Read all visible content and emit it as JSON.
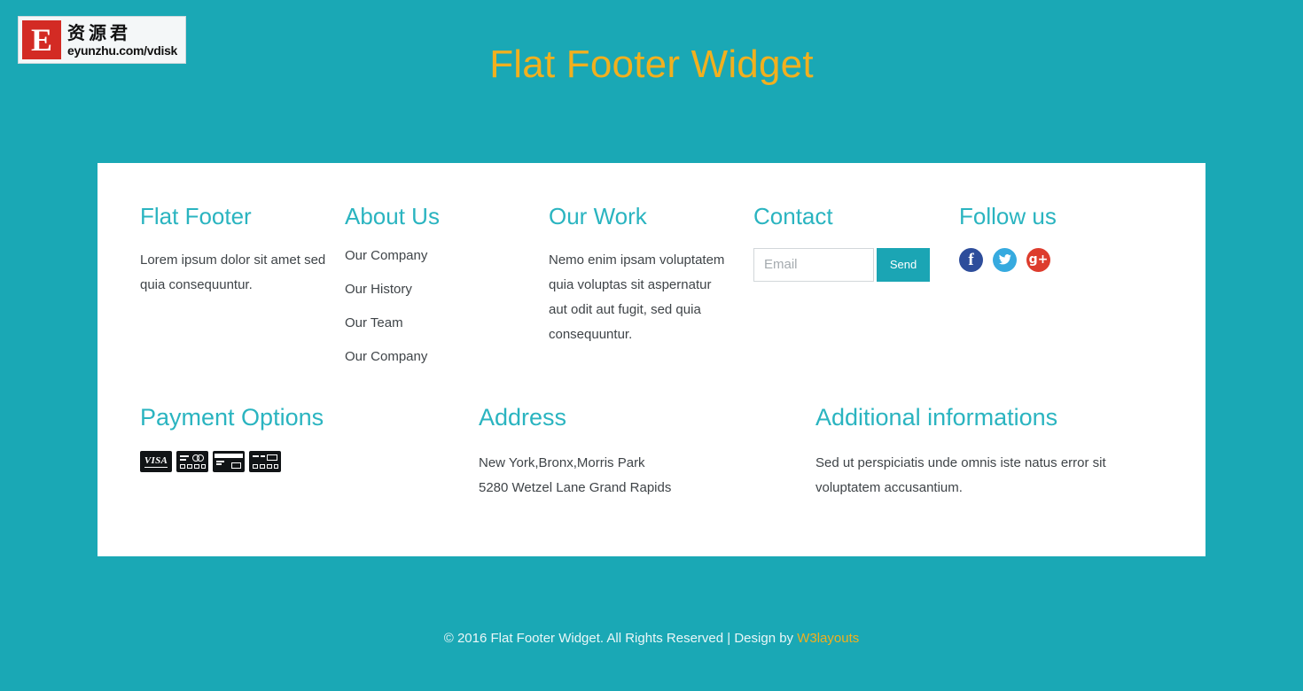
{
  "logo": {
    "mark": "E",
    "cn_text": "资源君",
    "url_text": "eyunzhu.com/vdisk"
  },
  "page": {
    "title": "Flat Footer Widget",
    "title_color": "#f2b01e",
    "background_color": "#1aa8b5",
    "card_background": "#ffffff",
    "heading_color": "#2ab4c0",
    "body_text_color": "#3f4448"
  },
  "footer": {
    "columns": [
      {
        "heading": "Flat Footer",
        "text": "Lorem ipsum dolor sit amet sed quia consequuntur."
      },
      {
        "heading": "About Us",
        "links": [
          "Our Company",
          "Our History",
          "Our Team",
          "Our Company"
        ]
      },
      {
        "heading": "Our Work",
        "text": "Nemo enim ipsam voluptatem quia voluptas sit aspernatur aut odit aut fugit, sed quia consequuntur."
      },
      {
        "heading": "Contact",
        "email_placeholder": "Email",
        "email_value": "",
        "send_label": "Send",
        "send_color": "#1ba5b4"
      },
      {
        "heading": "Follow us",
        "social": [
          {
            "name": "facebook",
            "glyph": "f",
            "color": "#2d4d9b"
          },
          {
            "name": "twitter",
            "glyph": "✒",
            "color": "#36aadf"
          },
          {
            "name": "google-plus",
            "glyph": "g+",
            "color": "#dd3c2d"
          }
        ]
      }
    ],
    "bottom_columns": [
      {
        "heading": "Payment Options",
        "cards": [
          "visa",
          "mastercard",
          "american-express",
          "discover"
        ]
      },
      {
        "heading": "Address",
        "lines": [
          "New York,Bronx,Morris Park",
          "5280 Wetzel Lane Grand Rapids"
        ]
      },
      {
        "heading": "Additional informations",
        "text": "Sed ut perspiciatis unde omnis iste natus error sit voluptatem accusantium."
      }
    ]
  },
  "copyright": {
    "text": "© 2016 Flat Footer Widget. All Rights Reserved | Design by ",
    "link_label": "W3layouts"
  }
}
